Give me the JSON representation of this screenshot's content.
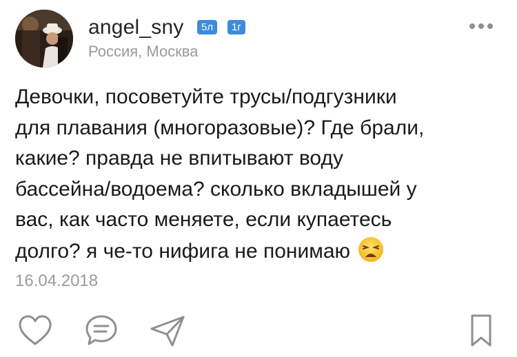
{
  "author": {
    "username": "angel_sny",
    "badges": [
      "5л",
      "1г"
    ],
    "location": "Россия, Москва"
  },
  "post": {
    "text": "Девочки, посоветуйте трусы/подгузники\nдля плавания (многоразовые)? Где брали,\nкакие? правда не впитывают воду\nбассейна/водоема? сколько вкладышей у\nвас, как часто меняете, если купаетесь\nдолго? я че-то нифига не понимаю ",
    "emoji": "weary-face-emoji",
    "date": "16.04.2018"
  },
  "icons": {
    "more": "more-dots-icon",
    "like": "heart-icon",
    "comment": "comment-icon",
    "share": "send-icon",
    "bookmark": "bookmark-icon"
  },
  "colors": {
    "badge": "#3d8bdb",
    "muted_text": "#9a9a9a",
    "icon": "#8e8e93"
  }
}
